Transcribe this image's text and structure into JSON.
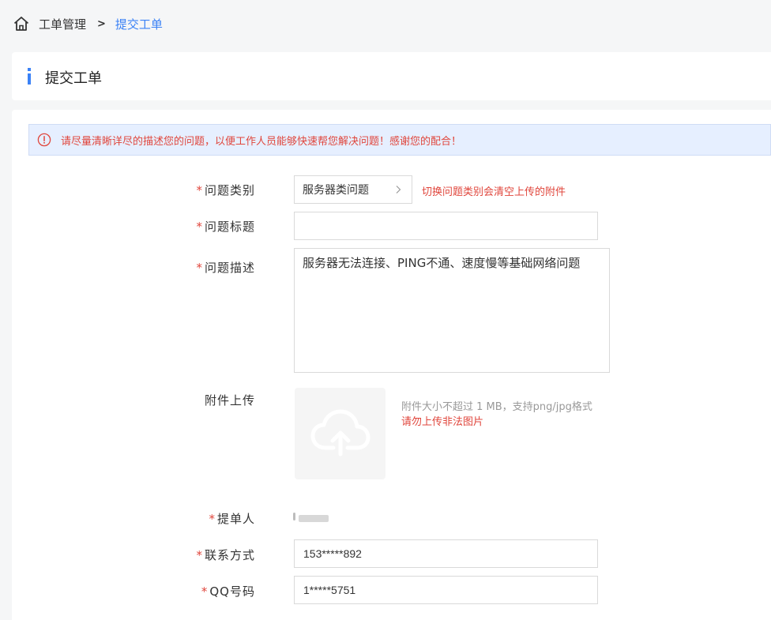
{
  "breadcrumb": {
    "home_icon": "home-icon",
    "parent": "工单管理",
    "separator": ">",
    "current": "提交工单"
  },
  "page_title": "提交工单",
  "notice": {
    "icon": "warning-circle-icon",
    "text": "请尽量清晰详尽的描述您的问题，以便工作人员能够快速帮您解决问题！感谢您的配合！"
  },
  "form": {
    "required_mark": "*",
    "category": {
      "label": "问题类别",
      "value": "服务器类问题",
      "hint": "切换问题类别会清空上传的附件"
    },
    "title": {
      "label": "问题标题",
      "value": ""
    },
    "description": {
      "label": "问题描述",
      "value": "服务器无法连接、PING不通、速度慢等基础网络问题"
    },
    "attachment": {
      "label": "附件上传",
      "hint_size": "附件大小不超过 1 MB，支持png/jpg格式",
      "hint_warning": "请勿上传非法图片",
      "icon": "cloud-upload-icon"
    },
    "submitter": {
      "label": "提单人"
    },
    "contact": {
      "label": "联系方式",
      "value": "153*****892"
    },
    "qq": {
      "label": "QQ号码",
      "value": "1*****5751"
    }
  },
  "colors": {
    "accent": "#3b82f6",
    "required": "#e0463c",
    "notice_bg": "#e6efff"
  }
}
